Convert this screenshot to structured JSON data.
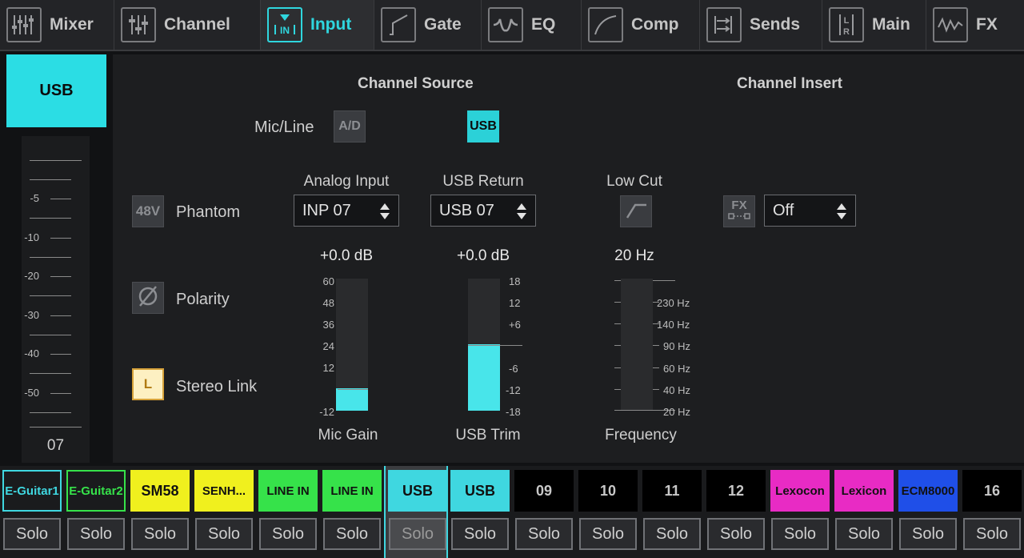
{
  "tabs": [
    {
      "label": "Mixer",
      "icon": "mixer-icon",
      "active": false
    },
    {
      "label": "Channel",
      "icon": "channel-icon",
      "active": false
    },
    {
      "label": "Input",
      "icon": "input-icon",
      "active": true,
      "icon_text": "IN"
    },
    {
      "label": "Gate",
      "icon": "gate-icon",
      "active": false
    },
    {
      "label": "EQ",
      "icon": "eq-icon",
      "active": false
    },
    {
      "label": "Comp",
      "icon": "comp-icon",
      "active": false
    },
    {
      "label": "Sends",
      "icon": "sends-icon",
      "active": false
    },
    {
      "label": "Main",
      "icon": "main-icon",
      "active": false,
      "icon_text": "L R"
    },
    {
      "label": "FX",
      "icon": "fx-icon",
      "active": false
    }
  ],
  "left_strip": {
    "source_button": "USB",
    "fader_labels": [
      "-5",
      "-10",
      "-20",
      "-30",
      "-40",
      "-50"
    ],
    "channel_number": "07"
  },
  "channel_source": {
    "heading": "Channel Source",
    "mic_line_label": "Mic/Line",
    "ad_button": "A/D",
    "usb_button": "USB"
  },
  "channel_insert": {
    "heading": "Channel Insert",
    "fx_button": "FX",
    "select_value": "Off"
  },
  "phantom": {
    "button": "48V",
    "label": "Phantom"
  },
  "polarity": {
    "label": "Polarity"
  },
  "stereo_link": {
    "button": "L",
    "label": "Stereo Link"
  },
  "analog_input": {
    "label": "Analog Input",
    "value": "INP 07",
    "gain_value": "+0.0 dB",
    "meter_label": "Mic Gain",
    "scale": [
      "60",
      "48",
      "36",
      "24",
      "12",
      "-12"
    ],
    "level_fraction": 0.17
  },
  "usb_return": {
    "label": "USB Return",
    "value": "USB 07",
    "trim_value": "+0.0 dB",
    "meter_label": "USB Trim",
    "scale": [
      "18",
      "12",
      "+6",
      "-6",
      "-12",
      "-18"
    ],
    "level_fraction": 0.5
  },
  "low_cut": {
    "label": "Low Cut",
    "freq_value": "20 Hz",
    "meter_label": "Frequency",
    "scale": [
      "230 Hz",
      "140 Hz",
      "90 Hz",
      "60 Hz",
      "40 Hz",
      "20 Hz"
    ]
  },
  "channels": [
    {
      "name": "E-Guitar1",
      "color": "#3fd7e0",
      "solo": "Solo"
    },
    {
      "name": "E-Guitar2",
      "color": "#36e24a",
      "solo": "Solo"
    },
    {
      "name": "SM58",
      "color": "#f0f01e",
      "solo": "Solo"
    },
    {
      "name": "SENH...",
      "color": "#f0f01e",
      "solo": "Solo"
    },
    {
      "name": "LINE IN",
      "color": "#36e24a",
      "solo": "Solo"
    },
    {
      "name": "LINE IN",
      "color": "#36e24a",
      "solo": "Solo"
    },
    {
      "name": "USB",
      "color": "#3fd7e0",
      "solo": "Solo"
    },
    {
      "name": "USB",
      "color": "#3fd7e0",
      "solo": "Solo"
    },
    {
      "name": "09",
      "color": "#000000",
      "solo": "Solo"
    },
    {
      "name": "10",
      "color": "#000000",
      "solo": "Solo"
    },
    {
      "name": "11",
      "color": "#000000",
      "solo": "Solo"
    },
    {
      "name": "12",
      "color": "#000000",
      "solo": "Solo"
    },
    {
      "name": "Lexocon",
      "color": "#e82bc4",
      "solo": "Solo"
    },
    {
      "name": "Lexicon",
      "color": "#e82bc4",
      "solo": "Solo"
    },
    {
      "name": "ECM8000",
      "color": "#1f4fe8",
      "solo": "Solo"
    },
    {
      "name": "16",
      "color": "#000000",
      "solo": "Solo"
    }
  ],
  "colors": {
    "accent": "#2bdde4",
    "meter_fill": "#48e5ea"
  }
}
